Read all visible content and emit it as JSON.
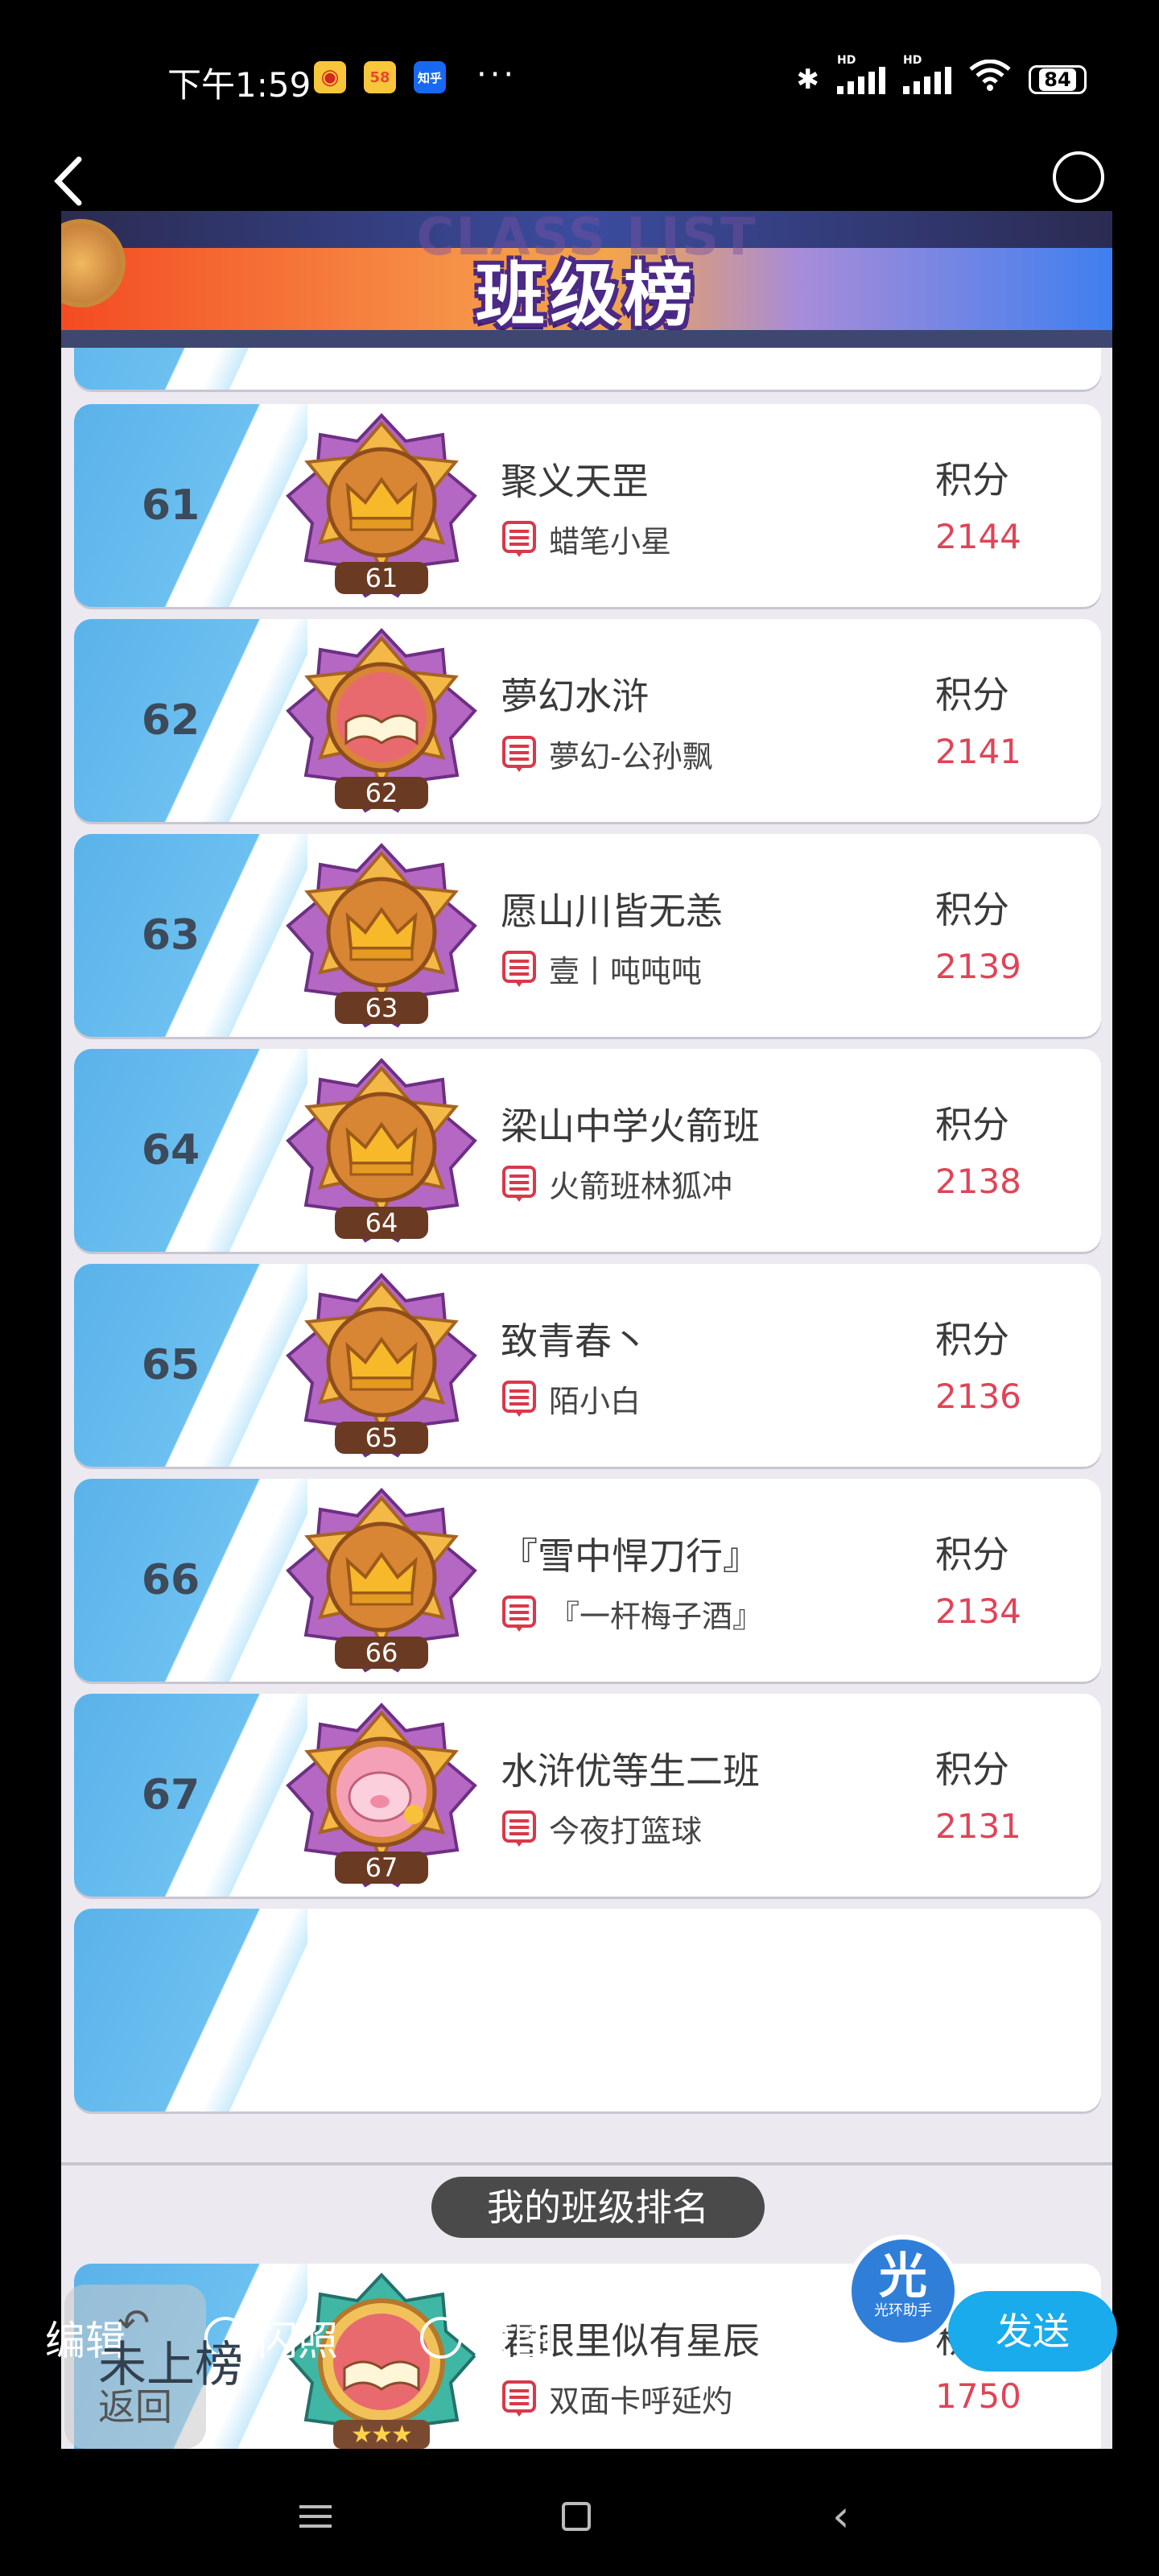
{
  "status_bar": {
    "time": "下午1:59",
    "battery": "84",
    "app_icons": [
      "weibo-icon",
      "58-icon",
      "zhihu-icon"
    ]
  },
  "header": {
    "banner_subtitle": "CLASS LIST",
    "banner_title": "班级榜"
  },
  "score_label": "积分",
  "rows": [
    {
      "rank": "61",
      "badge_number": "61",
      "badge_type": "crown",
      "class_name": "聚义天罡",
      "leader": "蜡笔小星",
      "score": "2144"
    },
    {
      "rank": "62",
      "badge_number": "62",
      "badge_type": "book",
      "class_name": "夢幻水浒",
      "leader": "夢幻-公孙飘",
      "score": "2141"
    },
    {
      "rank": "63",
      "badge_number": "63",
      "badge_type": "crown",
      "class_name": "愿山川皆无恙",
      "leader": "壹丨吨吨吨",
      "score": "2139"
    },
    {
      "rank": "64",
      "badge_number": "64",
      "badge_type": "crown",
      "class_name": "梁山中学火箭班",
      "leader": "火箭班林狐冲",
      "score": "2138"
    },
    {
      "rank": "65",
      "badge_number": "65",
      "badge_type": "crown",
      "class_name": "致青春丶",
      "leader": "陌小白",
      "score": "2136"
    },
    {
      "rank": "66",
      "badge_number": "66",
      "badge_type": "crown",
      "class_name": "『雪中悍刀行』",
      "leader": "『一杆梅子酒』",
      "score": "2134"
    },
    {
      "rank": "67",
      "badge_number": "67",
      "badge_type": "pig",
      "class_name": "水浒优等生二班",
      "leader": "今夜打篮球",
      "score": "2131"
    }
  ],
  "my_class": {
    "section_title": "我的班级排名",
    "rank": "未上榜",
    "class_name": "君眼里似有星辰",
    "leader": "双面卡呼延灼",
    "score": "1750",
    "stars": 3
  },
  "bottom": {
    "edit": "编辑",
    "flash": "闪照",
    "original": "原图",
    "send": "发送",
    "back": "返回",
    "floater_main": "光",
    "floater_sub": "光环助手"
  },
  "colors": {
    "score": "#e04457",
    "rank_strip": "#5ab2ea",
    "send": "#1aabec"
  }
}
